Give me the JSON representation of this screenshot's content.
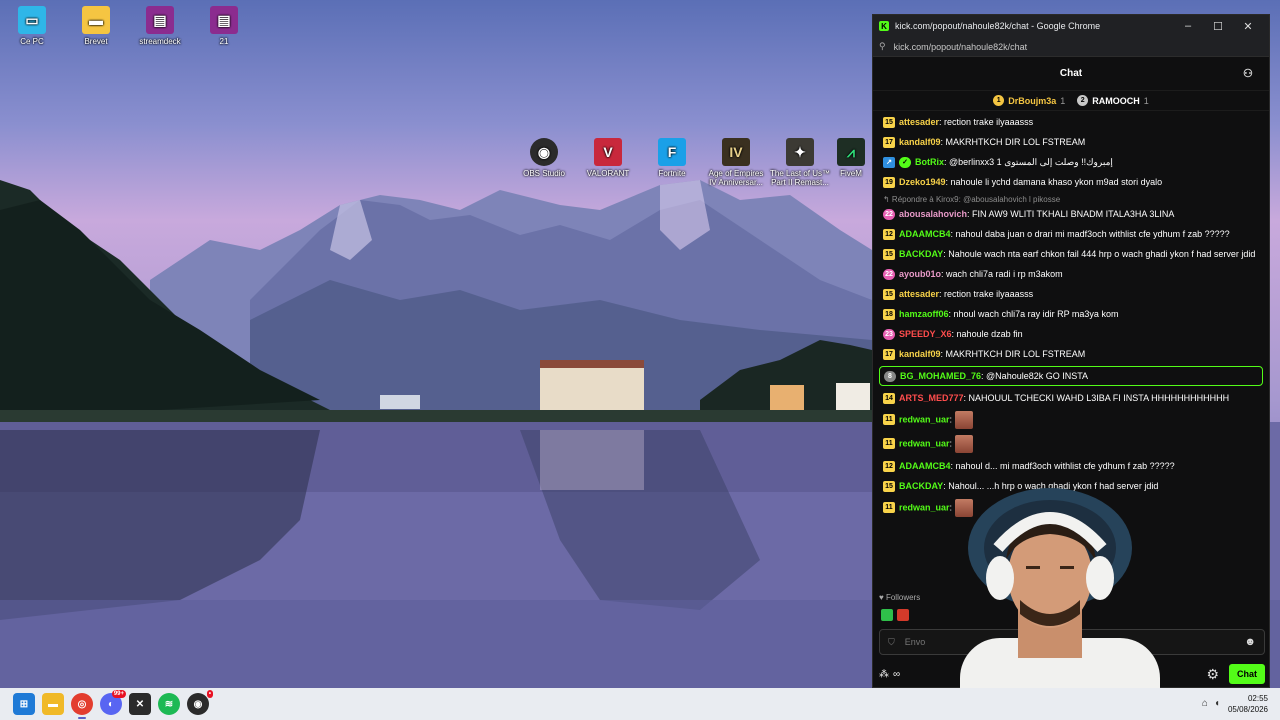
{
  "desktop": {
    "icons_left": [
      {
        "label": "Ce PC",
        "icon": "monitor-icon",
        "color": "#2fb6e8"
      },
      {
        "label": "Brevet",
        "icon": "folder-icon",
        "color": "#f5c542"
      },
      {
        "label": "streamdeck",
        "icon": "winrar-icon",
        "color": "#8b2c8f"
      },
      {
        "label": "21",
        "icon": "winrar-icon",
        "color": "#8b2c8f"
      }
    ],
    "icons_row": [
      {
        "label": "OBS Studio",
        "icon": "obs-icon",
        "color": "#2b2b2b",
        "glyph": "◉"
      },
      {
        "label": "VALORANT",
        "icon": "valorant-icon",
        "color": "#c8283c",
        "glyph": "V"
      },
      {
        "label": "Fortnite",
        "icon": "fortnite-icon",
        "color": "#1aa0e8",
        "glyph": "F"
      },
      {
        "label": "Age of Empires IV Anniversar...",
        "icon": "aoe-icon",
        "color": "#3a3020",
        "glyph": "IV"
      },
      {
        "label": "The Last of Us™ Part II Remast...",
        "icon": "tlou-icon",
        "color": "#3c3a34",
        "glyph": "✦"
      },
      {
        "label": "FiveM",
        "icon": "fivem-icon",
        "color": "#1e2e24",
        "glyph": "⩘"
      }
    ]
  },
  "window": {
    "title": "kick.com/popout/nahoule82k/chat - Google Chrome",
    "url": "kick.com/popout/nahoule82k/chat",
    "minimize": "–",
    "maximize": "☐",
    "close": "✕"
  },
  "chat": {
    "header": "Chat",
    "pinned": [
      {
        "rank": "1",
        "name": "DrBoujm3a",
        "count": "1",
        "rank_color": "#f4c542",
        "name_color": "#f4c542"
      },
      {
        "rank": "2",
        "name": "RAMOOCH",
        "count": "1",
        "rank_color": "#c8c8c8",
        "name_color": "#ffffff"
      }
    ],
    "reply_context": "↰ Répondre à Kirox9: @abousalahovich l pikosse",
    "messages": [
      {
        "badge": "15",
        "badge_type": "",
        "user": "attesader",
        "color": "#f8d34a",
        "text": "rection trake ilyaaasss"
      },
      {
        "badge": "17",
        "badge_type": "",
        "user": "kandalf09",
        "color": "#f8d34a",
        "text": "MAKRHTKCH DIR LOL FSTREAM"
      },
      {
        "badge": "↗",
        "badge_type": "sub",
        "badge2": "✓",
        "user": "BotRix",
        "color": "#53fc18",
        "text": "@berlinxx3 1 إمبروك!! وصلت إلى المستوى"
      },
      {
        "badge": "19",
        "badge_type": "",
        "user": "Dzeko1949",
        "color": "#f8d34a",
        "text": "nahoule li ychd damana khaso ykon m9ad stori dyalo"
      },
      {
        "badge": "22",
        "badge_type": "pink",
        "user": "abousalahovich",
        "color": "#e89ac8",
        "text": "FIN AW9 WLITI TKHALI BNADM ITALA3HA 3LINA",
        "reply": true
      },
      {
        "badge": "12",
        "badge_type": "",
        "user": "ADAAMCB4",
        "color": "#53fc18",
        "text": "nahoul daba juan o drari mi madf3och withlist cfe ydhum f zab ?????"
      },
      {
        "badge": "15",
        "badge_type": "",
        "user": "BACKDAY",
        "color": "#53fc18",
        "text": "Nahoule wach nta earf chkon fail 444 hrp o wach ghadi ykon f had server jdid"
      },
      {
        "badge": "22",
        "badge_type": "pink",
        "user": "ayoub01o",
        "color": "#e89ac8",
        "text": "wach chli7a radi i rp m3akom"
      },
      {
        "badge": "15",
        "badge_type": "",
        "user": "attesader",
        "color": "#f8d34a",
        "text": "rection trake ilyaaasss"
      },
      {
        "badge": "18",
        "badge_type": "",
        "user": "hamzaoff06",
        "color": "#53fc18",
        "text": "nhoul wach chli7a ray idir RP ma3ya kom"
      },
      {
        "badge": "23",
        "badge_type": "pink",
        "user": "SPEEDY_X6",
        "color": "#ff4d4d",
        "text": "nahoule dzab fin"
      },
      {
        "badge": "17",
        "badge_type": "",
        "user": "kandalf09",
        "color": "#f8d34a",
        "text": "MAKRHTKCH DIR LOL FSTREAM"
      },
      {
        "badge": "8",
        "badge_type": "gray",
        "user": "BG_MOHAMED_76",
        "color": "#53fc18",
        "text": "@Nahoule82k GO INSTA",
        "highlight": true
      },
      {
        "badge": "14",
        "badge_type": "",
        "user": "ARTS_MED777",
        "color": "#ff4d4d",
        "text": "NAHOUUL TCHECKI WAHD L3IBA FI INSTA HHHHHHHHHHHH"
      },
      {
        "badge": "11",
        "badge_type": "",
        "user": "redwan_uar",
        "color": "#53fc18",
        "text": "",
        "emote": true
      },
      {
        "badge": "11",
        "badge_type": "",
        "user": "redwan_uar",
        "color": "#53fc18",
        "text": "",
        "emote": true
      },
      {
        "badge": "12",
        "badge_type": "",
        "user": "ADAAMCB4",
        "color": "#53fc18",
        "text": "nahoul d... mi madf3och withlist cfe ydhum f zab ?????"
      },
      {
        "badge": "15",
        "badge_type": "",
        "user": "BACKDAY",
        "color": "#53fc18",
        "text": "Nahoul... ...h hrp o wach ghadi ykon f had server jdid"
      },
      {
        "badge": "11",
        "badge_type": "",
        "user": "redwan_uar",
        "color": "#53fc18",
        "text": "",
        "emote": true
      }
    ],
    "followers_label": "♥ Followers",
    "input_placeholder": "Envo",
    "send_label": "Chat"
  },
  "taskbar": {
    "apps": [
      {
        "name": "start",
        "icon": "windows-icon",
        "color": "#1f7ad6",
        "glyph": "⊞"
      },
      {
        "name": "explorer",
        "icon": "file-explorer-icon",
        "color": "#f0b928",
        "glyph": "▬"
      },
      {
        "name": "chrome",
        "icon": "chrome-icon",
        "color": "#e33d2f",
        "glyph": "◎",
        "active": true
      },
      {
        "name": "discord",
        "icon": "discord-icon",
        "color": "#5865f2",
        "glyph": "◐",
        "badge": "99+"
      },
      {
        "name": "capcut",
        "icon": "app-x-icon",
        "color": "#2b2b2b",
        "glyph": "✕"
      },
      {
        "name": "spotify",
        "icon": "spotify-icon",
        "color": "#1db954",
        "glyph": "≋"
      },
      {
        "name": "obs",
        "icon": "obs-tray-icon",
        "color": "#2b2b2b",
        "glyph": "◉",
        "badge": "•"
      }
    ],
    "time": "02:55",
    "date": "05/08/2026"
  }
}
